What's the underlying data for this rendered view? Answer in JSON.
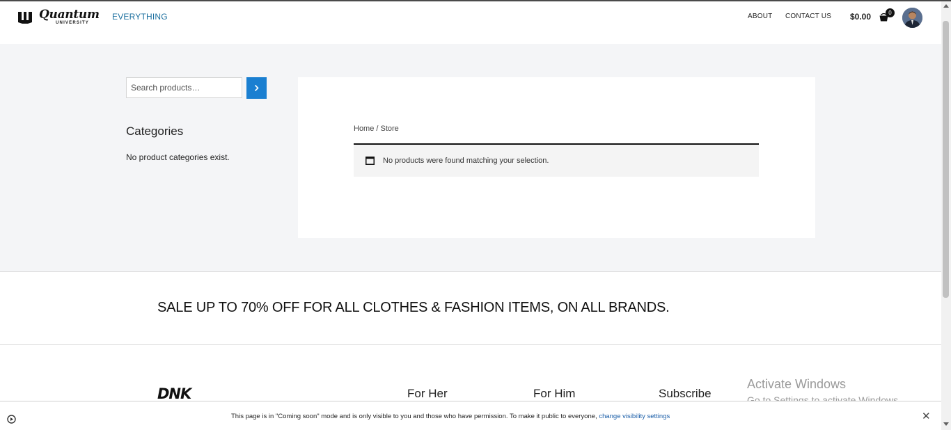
{
  "header": {
    "logo_title": "Quantum",
    "logo_subtitle": "UNIVERSITY",
    "nav_everything": "EVERYTHING",
    "nav_about": "ABOUT",
    "nav_contact": "CONTACT US",
    "cart_total": "$0.00",
    "cart_count": "0"
  },
  "sidebar": {
    "search_placeholder": "Search products…",
    "categories_title": "Categories",
    "categories_empty": "No product categories exist."
  },
  "main": {
    "breadcrumb": "Home / Store",
    "notice": "No products were found matching your selection."
  },
  "promo": {
    "text": "SALE UP TO 70% OFF FOR ALL CLOTHES & FASHION ITEMS, ON ALL BRANDS."
  },
  "footer": {
    "logo_text": "DNK",
    "col1": "For Her",
    "col2": "For Him",
    "col3": "Subscribe"
  },
  "watermark": {
    "line1": "Activate Windows",
    "line2": "Go to Settings to activate Windows."
  },
  "bottom_bar": {
    "message": "This page is in \"Coming soon\" mode and is only visible to you and those who have permission. To make it public to everyone, ",
    "link": "change visibility settings"
  },
  "colors": {
    "accent": "#1a7fd1",
    "nav_link": "#1a6e9e",
    "band_bg": "#f4f5f7"
  },
  "icons": [
    "logo-mark-icon",
    "cart-icon",
    "chevron-right-icon",
    "notice-icon",
    "play-icon",
    "close-icon"
  ]
}
